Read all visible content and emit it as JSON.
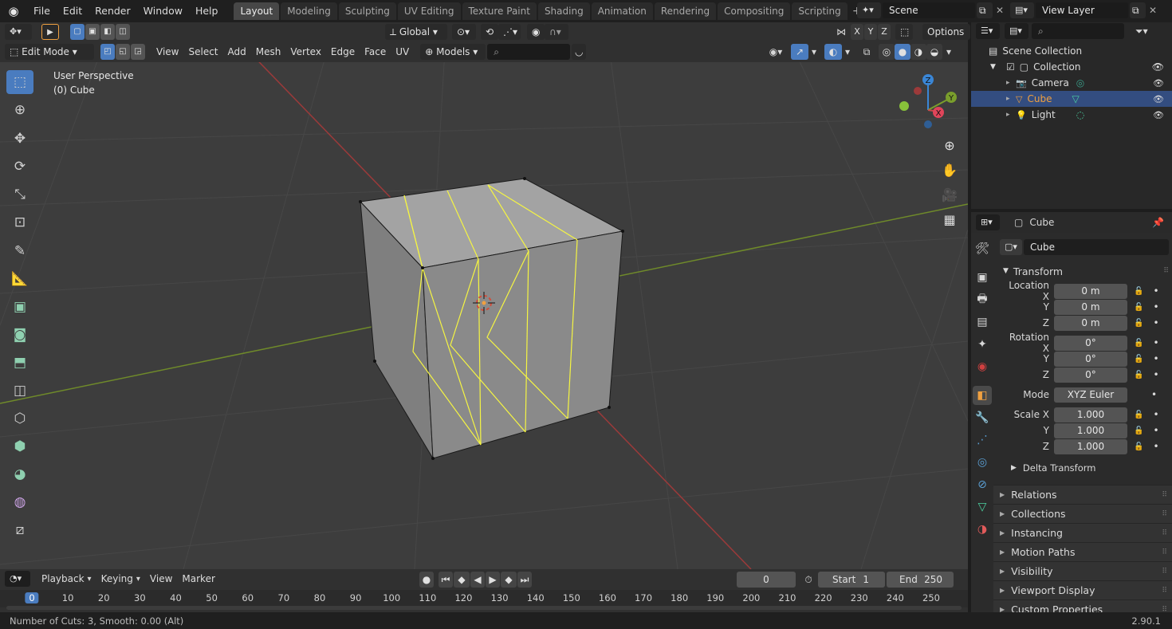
{
  "topbar": {
    "menus": [
      "File",
      "Edit",
      "Render",
      "Window",
      "Help"
    ],
    "tabs": [
      "Layout",
      "Modeling",
      "Sculpting",
      "UV Editing",
      "Texture Paint",
      "Shading",
      "Animation",
      "Rendering",
      "Compositing",
      "Scripting"
    ],
    "active_tab": "Layout",
    "scene_name": "Scene",
    "view_layer": "View Layer"
  },
  "viewport": {
    "transform_orientation": "Global",
    "options_label": "Options",
    "mode": "Edit Mode",
    "menus": [
      "View",
      "Select",
      "Add",
      "Mesh",
      "Vertex",
      "Edge",
      "Face",
      "UV"
    ],
    "models_label": "Models",
    "perspective_label": "User Perspective",
    "object_label": "(0) Cube",
    "gizmo_axes": {
      "x": "X",
      "y": "Y",
      "z": "Z"
    },
    "axis_toggles": [
      "X",
      "Y",
      "Z"
    ]
  },
  "outliner": {
    "root": "Scene Collection",
    "collection": "Collection",
    "items": [
      {
        "name": "Camera",
        "selected": false
      },
      {
        "name": "Cube",
        "selected": true
      },
      {
        "name": "Light",
        "selected": false
      }
    ]
  },
  "properties": {
    "object_name": "Cube",
    "name_field": "Cube",
    "transform_label": "Transform",
    "location_label": "Location X",
    "rotation_label": "Rotation X",
    "scale_label": "Scale X",
    "y_label": "Y",
    "z_label": "Z",
    "location": [
      "0 m",
      "0 m",
      "0 m"
    ],
    "rotation": [
      "0°",
      "0°",
      "0°"
    ],
    "mode_label": "Mode",
    "mode_value": "XYZ Euler",
    "scale": [
      "1.000",
      "1.000",
      "1.000"
    ],
    "delta_transform": "Delta Transform",
    "panels": [
      "Relations",
      "Collections",
      "Instancing",
      "Motion Paths",
      "Visibility",
      "Viewport Display",
      "Custom Properties"
    ]
  },
  "timeline": {
    "menus": [
      "Playback",
      "Keying",
      "View",
      "Marker"
    ],
    "current_frame": "0",
    "start_label": "Start",
    "start_value": "1",
    "end_label": "End",
    "end_value": "250",
    "ruler": [
      "0",
      "10",
      "20",
      "30",
      "40",
      "50",
      "60",
      "70",
      "80",
      "90",
      "100",
      "110",
      "120",
      "130",
      "140",
      "150",
      "160",
      "170",
      "180",
      "190",
      "200",
      "210",
      "220",
      "230",
      "240",
      "250"
    ],
    "playhead": "0"
  },
  "status": {
    "message": "Number of Cuts: 3, Smooth: 0.00 (Alt)",
    "version": "2.90.1"
  },
  "colors": {
    "accent": "#4a7cbf",
    "selection_edge": "#f5f542",
    "x_axis": "#c84a4a",
    "y_axis": "#7a9e2c",
    "z_axis": "#3a86d6",
    "active_object": "#f0a040"
  }
}
